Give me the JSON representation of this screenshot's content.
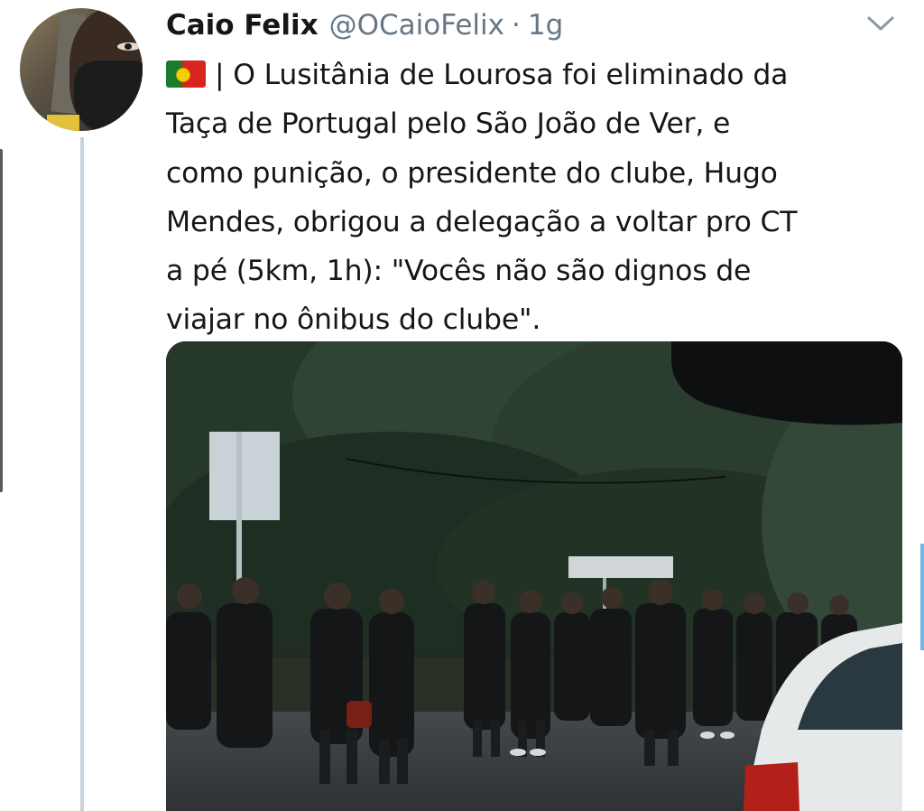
{
  "tweet": {
    "display_name": "Caio Felix",
    "handle": "@OCaioFelix",
    "separator": "·",
    "time": "1g",
    "flag_icon": "portugal-flag-icon",
    "text_lines": [
      "| O Lusitânia de Lourosa foi eliminado da",
      "Taça de Portugal pelo São João de Ver, e",
      "como punição, o presidente do clube, Hugo",
      "Mendes, obrigou a delegação a voltar pro CT",
      "a pé (5km, 1h): \"Vocês não são dignos de",
      "viajar no ônibus do clube\"."
    ],
    "media": {
      "type": "video-thumbnail",
      "description_icon": "video-still"
    }
  },
  "colors": {
    "text_primary": "#14171a",
    "text_secondary": "#657786",
    "thread_line": "#c8d3dc",
    "accent": "#1da1f2"
  }
}
